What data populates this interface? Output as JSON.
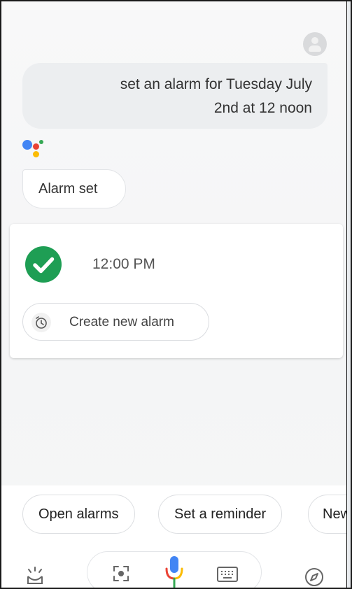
{
  "conversation": {
    "user_query": {
      "line1": "set an alarm for Tuesday July",
      "line2": "2nd at 12 noon"
    },
    "assistant_reply": "Alarm set"
  },
  "alarm_card": {
    "time": "12:00 PM",
    "status_icon": "check-circle-icon",
    "create_button_label": "Create new alarm"
  },
  "suggestions": [
    "Open alarms",
    "Set a reminder",
    "New"
  ],
  "bottom_bar": {
    "icons": [
      "updates-icon",
      "lens-icon",
      "mic-icon",
      "keyboard-icon",
      "explore-icon"
    ]
  },
  "colors": {
    "check_green": "#1e9e54",
    "google_blue": "#4285f4",
    "google_red": "#ea4335",
    "google_yellow": "#fbbc05",
    "google_green": "#34a853"
  }
}
